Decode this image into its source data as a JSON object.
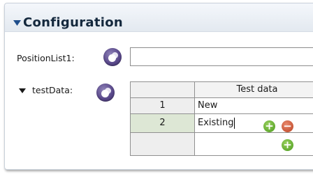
{
  "section": {
    "title": "Configuration"
  },
  "fields": {
    "position_list": {
      "label": "PositionList1:",
      "value": ""
    },
    "test_data": {
      "label": "testData:"
    }
  },
  "table": {
    "column_header": "Test data",
    "rows": [
      {
        "index": "1",
        "value": "New"
      },
      {
        "index": "2",
        "value": "Existing"
      },
      {
        "index": "",
        "value": ""
      }
    ]
  },
  "icons": {
    "collapse": "triangle-down-icon",
    "picker": "variable-picker-icon",
    "add": "plus-circle-icon",
    "remove": "minus-circle-icon"
  },
  "colors": {
    "header_bg": "#e3e9f0",
    "title": "#14283d",
    "selected_row": "#dde7d5",
    "add": "#4a9a1c",
    "remove": "#b8401f"
  }
}
